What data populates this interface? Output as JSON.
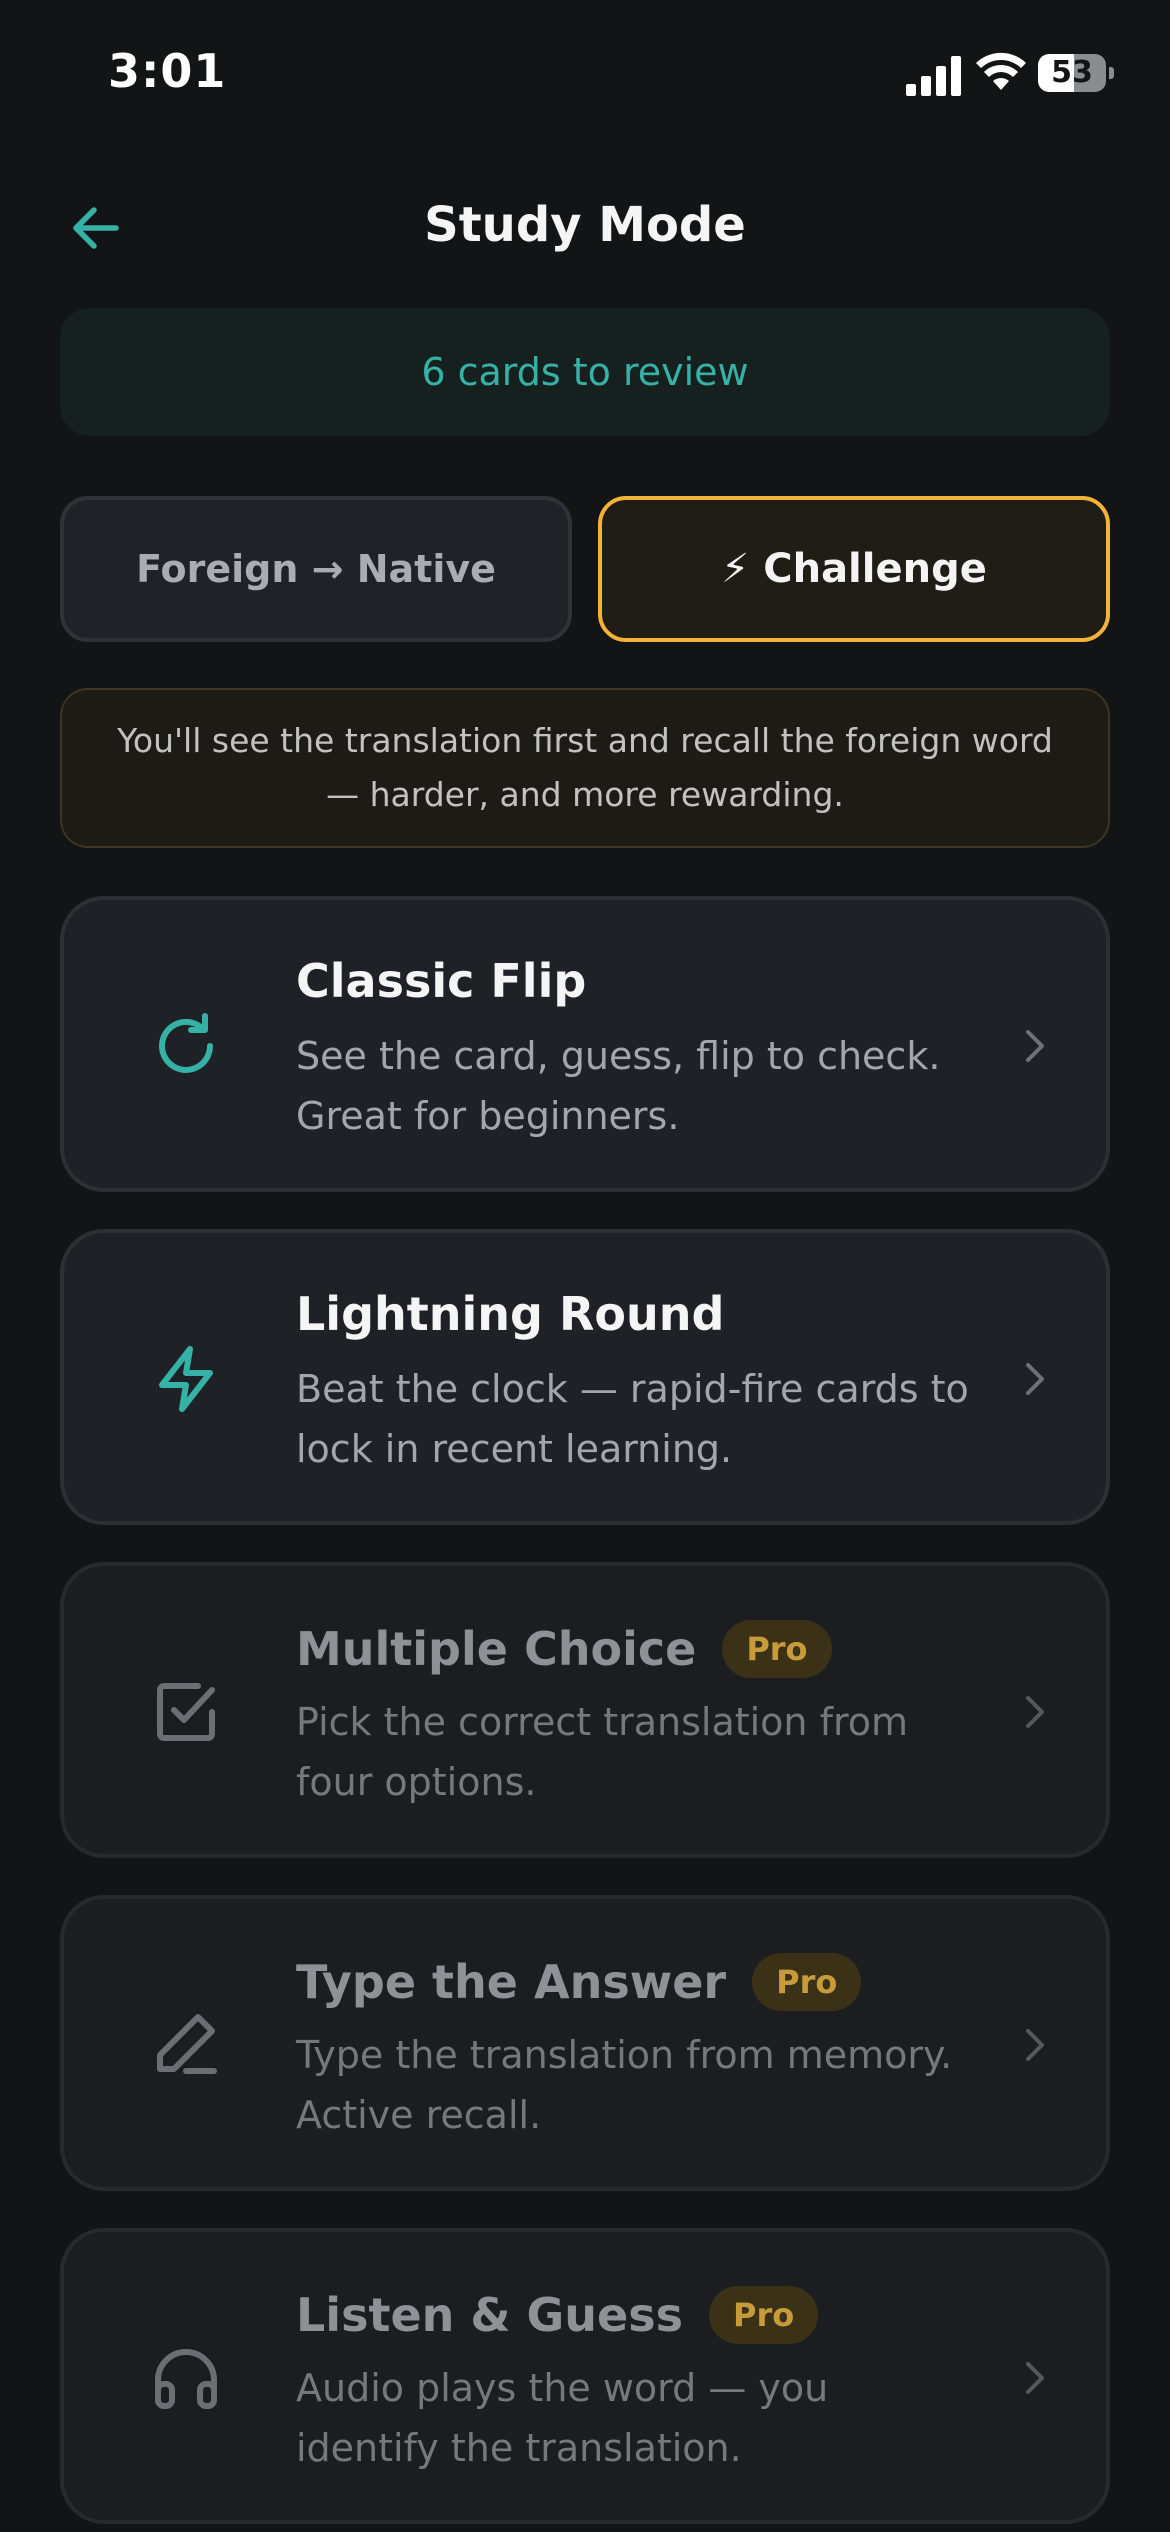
{
  "status_bar": {
    "time": "3:01",
    "battery_level": "53"
  },
  "header": {
    "title": "Study Mode"
  },
  "review": {
    "label": "6 cards to review"
  },
  "direction": {
    "native_label": "Foreign → Native",
    "challenge_emoji": "⚡",
    "challenge_label": "Challenge",
    "selected": "Challenge",
    "hint": "You'll see the translation first and recall the foreign word — harder, and more rewarding."
  },
  "modes": [
    {
      "title": "Classic Flip",
      "description": "See the card, guess, flip to check. Great for beginners.",
      "icon": "refresh-icon",
      "pro": false
    },
    {
      "title": "Lightning Round",
      "description": "Beat the clock — rapid-fire cards to lock in recent learning.",
      "icon": "lightning-icon",
      "pro": false
    },
    {
      "title": "Multiple Choice",
      "badge": "Pro",
      "description": "Pick the correct translation from four options.",
      "icon": "checkbox-icon",
      "pro": true
    },
    {
      "title": "Type the Answer",
      "badge": "Pro",
      "description": "Type the translation from memory. Active recall.",
      "icon": "pencil-icon",
      "pro": true
    },
    {
      "title": "Listen & Guess",
      "badge": "Pro",
      "description": "Audio plays the word — you identify the translation.",
      "icon": "headphones-icon",
      "pro": true
    }
  ],
  "colors": {
    "background": "#121416",
    "accent_teal": "#35b1a6",
    "accent_gold": "#f3b338",
    "pro_badge_text": "#c79a3a"
  }
}
